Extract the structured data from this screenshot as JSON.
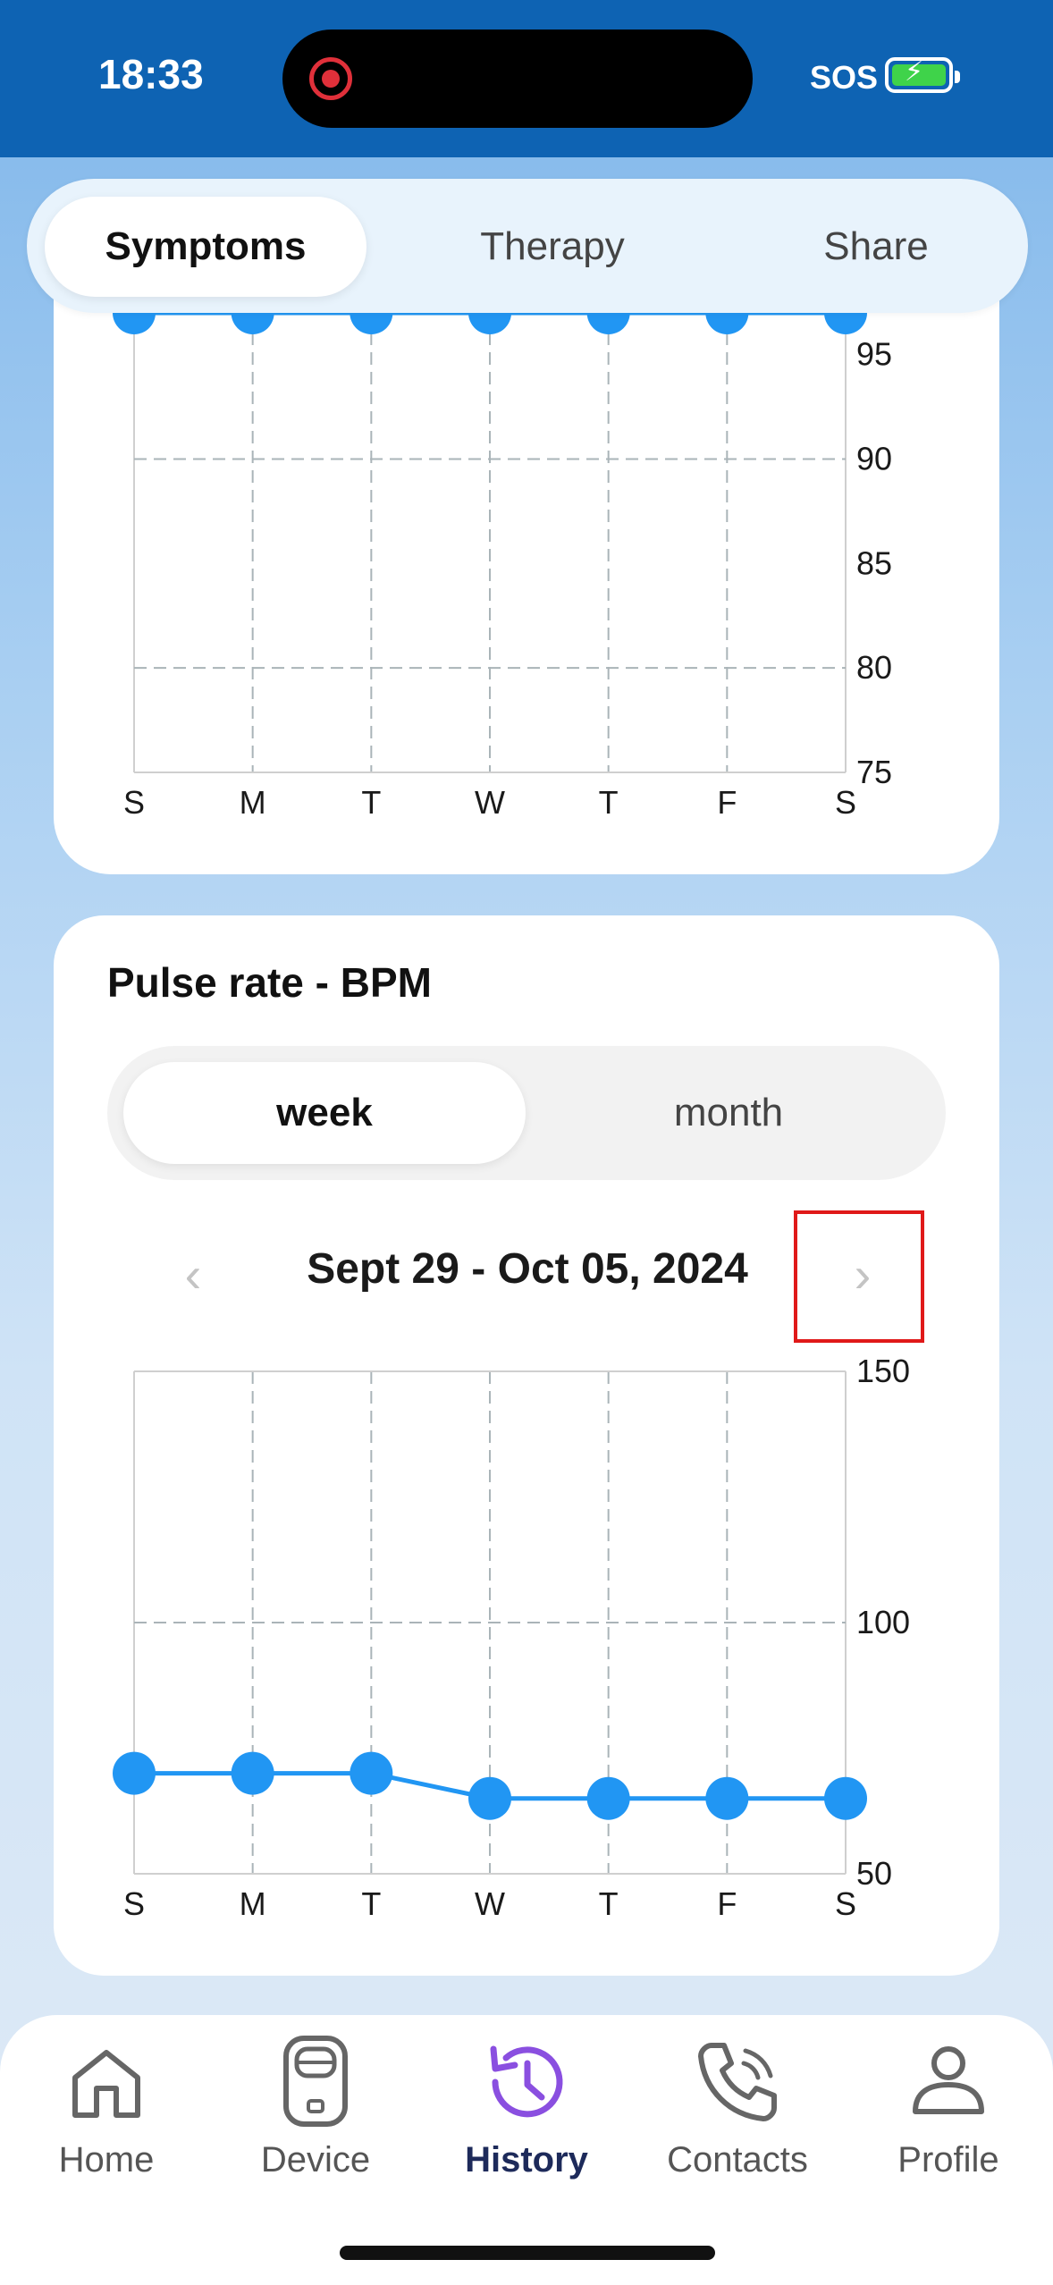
{
  "status_bar": {
    "time": "18:33",
    "sos": "SOS"
  },
  "top_tabs": [
    {
      "label": "Symptoms",
      "active": true
    },
    {
      "label": "Therapy",
      "active": false
    },
    {
      "label": "Share",
      "active": false
    }
  ],
  "pulse_card": {
    "title": "Pulse rate - BPM",
    "period_options": [
      {
        "label": "week",
        "active": true
      },
      {
        "label": "month",
        "active": false
      }
    ],
    "date_range": "Sept 29 - Oct 05, 2024",
    "prev_icon": "chevron-left-icon",
    "next_icon": "chevron-right-icon"
  },
  "chart_data": [
    {
      "type": "line",
      "title": "",
      "x": [
        "S",
        "M",
        "T",
        "W",
        "T",
        "F",
        "S"
      ],
      "yticks": [
        95,
        90,
        85,
        80,
        75
      ],
      "ylim": [
        75,
        97
      ],
      "grid": true,
      "series": [
        {
          "values": [
            97,
            97,
            97,
            97,
            97,
            97,
            97
          ]
        }
      ],
      "color": "#2196f3",
      "note_visible": "chart partially scrolled; top edge cut off"
    },
    {
      "type": "line",
      "title": "Pulse rate - BPM",
      "x": [
        "S",
        "M",
        "T",
        "W",
        "T",
        "F",
        "S"
      ],
      "yticks": [
        150,
        100,
        50
      ],
      "ylim": [
        50,
        150
      ],
      "grid": true,
      "series": [
        {
          "values": [
            70,
            70,
            70,
            65,
            65,
            65,
            65
          ]
        }
      ],
      "color": "#2196f3"
    }
  ],
  "bottom_nav": [
    {
      "label": "Home",
      "icon": "home-icon",
      "active": false
    },
    {
      "label": "Device",
      "icon": "device-icon",
      "active": false
    },
    {
      "label": "History",
      "icon": "history-icon",
      "active": true
    },
    {
      "label": "Contacts",
      "icon": "phone-icon",
      "active": false
    },
    {
      "label": "Profile",
      "icon": "profile-icon",
      "active": false
    }
  ],
  "colors": {
    "accent": "#2196f3",
    "history_active": "#8a4fe0",
    "status_bar": "#0e63b3",
    "highlight": "#e01919"
  }
}
